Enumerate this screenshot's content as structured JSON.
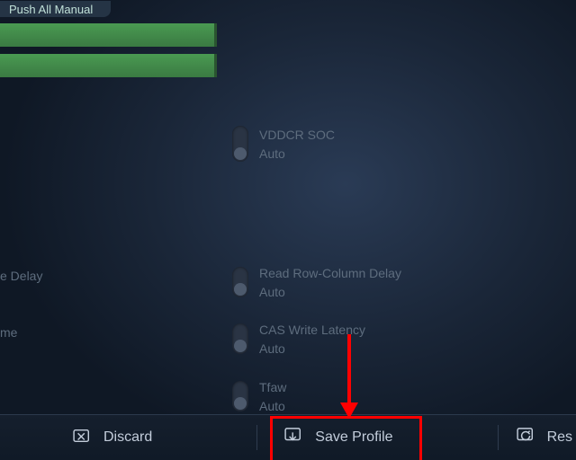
{
  "tab": {
    "label": "Push All Manual"
  },
  "bar1": {
    "fill_percent": 95
  },
  "bar2": {
    "fill_percent": 95
  },
  "settings": {
    "vddcr_soc": {
      "label": "VDDCR SOC",
      "value": "Auto"
    },
    "read_rc": {
      "label": "Read Row-Column Delay",
      "value": "Auto"
    },
    "cas_wl": {
      "label": "CAS Write Latency",
      "value": "Auto"
    },
    "tfaw": {
      "label": "Tfaw",
      "value": "Auto"
    }
  },
  "cut_left": {
    "row1": "e Delay",
    "row2": "me"
  },
  "footer": {
    "discard": "Discard",
    "save_profile": "Save Profile",
    "reset_fragment": "Res"
  }
}
